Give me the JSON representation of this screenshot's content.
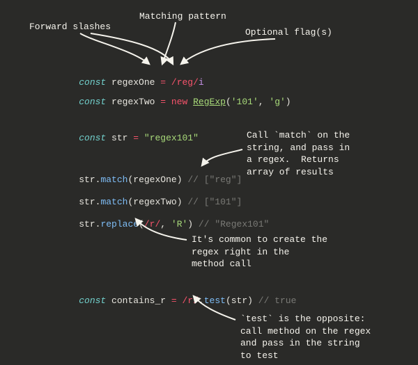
{
  "annotations": {
    "forwardSlashes": "Forward slashes",
    "matchingPattern": "Matching pattern",
    "optionalFlags": "Optional flag(s)",
    "matchExplain": "Call `match` on the\nstring, and pass in\na regex.  Returns\narray of results",
    "inlineRegex": "It's common to create the\nregex right in the\nmethod call",
    "testExplain": "`test` is the opposite:\ncall method on the regex\nand pass in the string\nto test"
  },
  "code": {
    "l1": {
      "const": "const",
      "name": "regexOne",
      "eq": "=",
      "regex": "/reg/",
      "flag": "i"
    },
    "l2": {
      "const": "const",
      "name": "regexTwo",
      "eq": "=",
      "new": "new",
      "ctor": "RegExp",
      "arg1": "'101'",
      "comma": ",",
      "arg2": "'g'",
      "close": ")"
    },
    "l3": {
      "const": "const",
      "name": "str",
      "eq": "=",
      "val": "\"regex101\""
    },
    "l4": {
      "obj": "str",
      "dot": ".",
      "fn": "match",
      "open": "(",
      "arg": "regexOne",
      "close": ")",
      "cmt": "// [\"reg\"]"
    },
    "l5": {
      "obj": "str",
      "dot": ".",
      "fn": "match",
      "open": "(",
      "arg": "regexTwo",
      "close": ")",
      "cmt": "// [\"101\"]"
    },
    "l6": {
      "obj": "str",
      "dot": ".",
      "fn": "replace",
      "open": "(",
      "rgx": "/r/",
      "comma": ",",
      "arg2": "'R'",
      "close": ")",
      "cmt": "// \"Regex101\""
    },
    "l7": {
      "const": "const",
      "name": "contains_r",
      "eq": "=",
      "rgx": "/r/",
      "dot": ".",
      "fn": "test",
      "open": "(",
      "arg": "str",
      "close": ")",
      "cmt": "// true"
    }
  }
}
